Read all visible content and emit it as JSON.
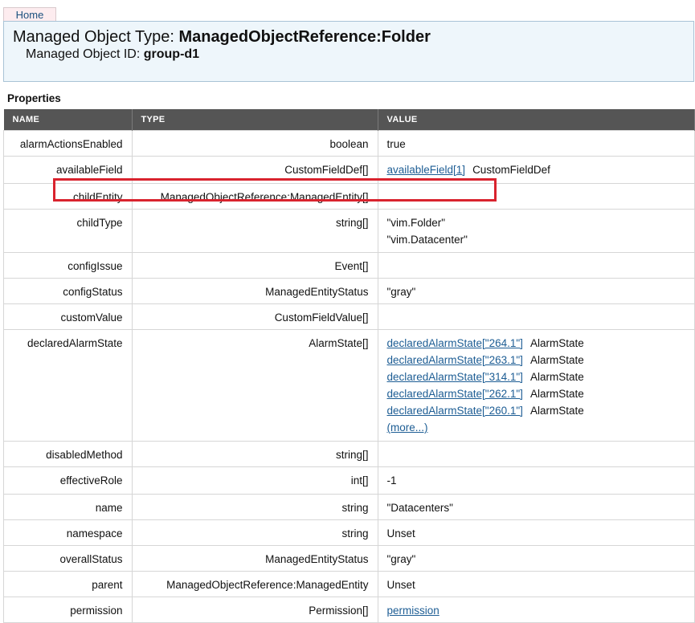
{
  "nav": {
    "home_label": "Home"
  },
  "header": {
    "type_label": "Managed Object Type:",
    "type_value": "ManagedObjectReference:Folder",
    "id_label": "Managed Object ID:",
    "id_value": "group-d1"
  },
  "section_title": "Properties",
  "columns": {
    "name": "NAME",
    "type": "TYPE",
    "value": "VALUE"
  },
  "rows": [
    {
      "name": "alarmActionsEnabled",
      "type": "boolean",
      "values": [
        {
          "text": "true"
        }
      ]
    },
    {
      "name": "availableField",
      "type": "CustomFieldDef[]",
      "values": [
        {
          "link": "availableField[1]",
          "text": "CustomFieldDef"
        }
      ]
    },
    {
      "name": "childEntity",
      "type": "ManagedObjectReference:ManagedEntity[]",
      "values": []
    },
    {
      "name": "childType",
      "type": "string[]",
      "values": [
        {
          "text": "\"vim.Folder\""
        },
        {
          "text": "\"vim.Datacenter\""
        }
      ]
    },
    {
      "name": "configIssue",
      "type": "Event[]",
      "values": []
    },
    {
      "name": "configStatus",
      "type": "ManagedEntityStatus",
      "values": [
        {
          "text": "\"gray\""
        }
      ]
    },
    {
      "name": "customValue",
      "type": "CustomFieldValue[]",
      "values": []
    },
    {
      "name": "declaredAlarmState",
      "type": "AlarmState[]",
      "values": [
        {
          "link": "declaredAlarmState[\"264.1\"]",
          "text": "AlarmState"
        },
        {
          "link": "declaredAlarmState[\"263.1\"]",
          "text": "AlarmState"
        },
        {
          "link": "declaredAlarmState[\"314.1\"]",
          "text": "AlarmState"
        },
        {
          "link": "declaredAlarmState[\"262.1\"]",
          "text": "AlarmState"
        },
        {
          "link": "declaredAlarmState[\"260.1\"]",
          "text": "AlarmState"
        },
        {
          "link": "(more...)"
        }
      ]
    },
    {
      "name": "disabledMethod",
      "type": "string[]",
      "values": []
    },
    {
      "name": "effectiveRole",
      "type": "int[]",
      "values": [
        {
          "text": "-1"
        }
      ]
    },
    {
      "name": "name",
      "type": "string",
      "values": [
        {
          "text": "\"Datacenters\""
        }
      ]
    },
    {
      "name": "namespace",
      "type": "string",
      "values": [
        {
          "text": "Unset"
        }
      ]
    },
    {
      "name": "overallStatus",
      "type": "ManagedEntityStatus",
      "values": [
        {
          "text": "\"gray\""
        }
      ]
    },
    {
      "name": "parent",
      "type": "ManagedObjectReference:ManagedEntity",
      "values": [
        {
          "text": "Unset"
        }
      ]
    },
    {
      "name": "permission",
      "type": "Permission[]",
      "values": [
        {
          "link": "permission"
        }
      ]
    }
  ],
  "colors": {
    "header_bg": "#555555",
    "highlight": "#d9232e",
    "link": "#1d5d94",
    "banner_bg": "#eef6fb"
  }
}
